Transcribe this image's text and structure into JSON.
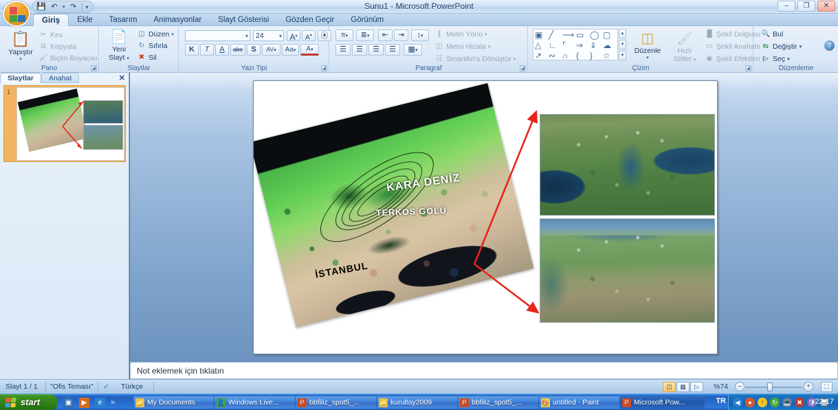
{
  "window": {
    "title": "Sunu1  -  Microsoft PowerPoint",
    "minimize": "–",
    "restore": "❐",
    "close": "✕",
    "help_icon": "?"
  },
  "quick_access": {
    "save_icon": "save-icon",
    "undo_icon": "undo-icon",
    "redo_icon": "redo-icon",
    "customize_icon": "chevron-down-icon"
  },
  "ribbon": {
    "tabs": [
      {
        "label": "Giriş",
        "active": true
      },
      {
        "label": "Ekle",
        "active": false
      },
      {
        "label": "Tasarım",
        "active": false
      },
      {
        "label": "Animasyonlar",
        "active": false
      },
      {
        "label": "Slayt Gösterisi",
        "active": false
      },
      {
        "label": "Gözden Geçir",
        "active": false
      },
      {
        "label": "Görünüm",
        "active": false
      }
    ],
    "groups": {
      "clipboard": {
        "title": "Pano",
        "paste": "Yapıştır",
        "cut": "Kes",
        "copy": "Kopyala",
        "format_painter": "Biçim Boyacısı"
      },
      "slides": {
        "title": "Slaytlar",
        "new_slide": "Yeni\nSlayt",
        "new_slide_line1": "Yeni",
        "new_slide_line2": "Slayt",
        "layout": "Düzen",
        "reset": "Sıfırla",
        "delete": "Sil"
      },
      "font": {
        "title": "Yazı Tipi",
        "font_name": "",
        "font_size": "24",
        "grow": "A",
        "shrink": "A",
        "clear_format": "clear-formatting-icon",
        "bold": "K",
        "italic": "T",
        "underline": "A",
        "strikethrough": "abc",
        "shadow": "S",
        "spacing": "AV",
        "change_case": "Aa",
        "font_color": "A"
      },
      "paragraph": {
        "title": "Paragraf",
        "text_direction": "Metin Yönü",
        "align_text": "Metni Hizala",
        "convert_smartart": "SmartArt'a Dönüştür"
      },
      "drawing": {
        "title": "Çizim",
        "arrange": "Düzenle",
        "quick_styles_line1": "Hızlı",
        "quick_styles_line2": "Stiller",
        "shape_fill": "Şekil Dolgusu",
        "shape_outline": "Şekil Anahattı",
        "shape_effects": "Şekil Efektleri"
      },
      "editing": {
        "title": "Düzenleme",
        "find": "Bul",
        "replace": "Değiştir",
        "select": "Seç"
      }
    }
  },
  "slides_pane": {
    "tab_slides": "Slaytlar",
    "tab_outline": "Anahat",
    "close_icon": "✕",
    "slide_number": "1"
  },
  "slide": {
    "map_labels": {
      "sea": "KARA DENİZ",
      "lake": "TERKOS GÖLÜ",
      "city": "İSTANBUL"
    },
    "arrow_color": "#e8241c"
  },
  "notes": {
    "placeholder": "Not eklemek için tıklatın"
  },
  "status_bar": {
    "slide_count": "Slayt 1 / 1",
    "theme": "\"Ofis Teması\"",
    "spell_icon": "spell-check-icon",
    "language": "Türkçe",
    "view_normal": "normal-view-icon",
    "view_sorter": "slide-sorter-icon",
    "view_show": "slide-show-icon",
    "zoom": "%74",
    "zoom_out": "–",
    "zoom_in": "+",
    "fit_window": "fit-to-window-icon"
  },
  "taskbar": {
    "start": "start",
    "quick_launch": [
      "show-desktop-icon",
      "media-player-icon",
      "internet-explorer-icon",
      "more-chevron-icon"
    ],
    "buttons": [
      {
        "label": "My Documents",
        "icon": "folder-icon",
        "active": false
      },
      {
        "label": "Windows Live...",
        "icon": "messenger-icon",
        "active": false
      },
      {
        "label": "bbfiliz_spot5_...",
        "icon": "powerpoint-icon",
        "active": false
      },
      {
        "label": "kurultay2009",
        "icon": "folder-icon",
        "active": false
      },
      {
        "label": "bbfiliz_spot5_...",
        "icon": "powerpoint-icon",
        "active": false
      },
      {
        "label": "untitled - Paint",
        "icon": "paint-icon",
        "active": false
      },
      {
        "label": "Microsoft Pow...",
        "icon": "powerpoint-icon",
        "active": true
      }
    ],
    "language_indicator": "TR",
    "tray_icons": [
      "show-hidden-icon",
      "antivirus-icon",
      "warning-icon",
      "update-icon",
      "network-icon",
      "network-error-icon",
      "shield-icon",
      "monitor-icon"
    ],
    "clock": "22:17"
  }
}
